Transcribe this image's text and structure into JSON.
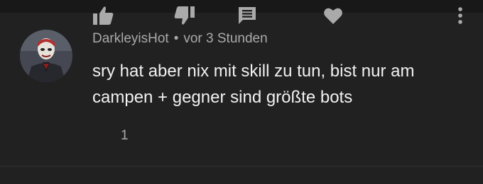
{
  "comment": {
    "author": "DarkleyisHot",
    "separator": "•",
    "timestamp": "vor 3 Stunden",
    "text": "sry hat aber nix mit skill zu tun, bist nur am campen + gegner sind größte bots",
    "like_count": "1"
  },
  "icons": {
    "like": "thumbs-up-icon",
    "dislike": "thumbs-down-icon",
    "reply": "comment-icon",
    "heart": "heart-icon",
    "more": "more-vert-icon"
  },
  "colors": {
    "background": "#212121",
    "divider": "#181818",
    "primary_text": "#f1f1f1",
    "secondary_text": "#aaaaaa",
    "icon": "#aaaaaa"
  }
}
